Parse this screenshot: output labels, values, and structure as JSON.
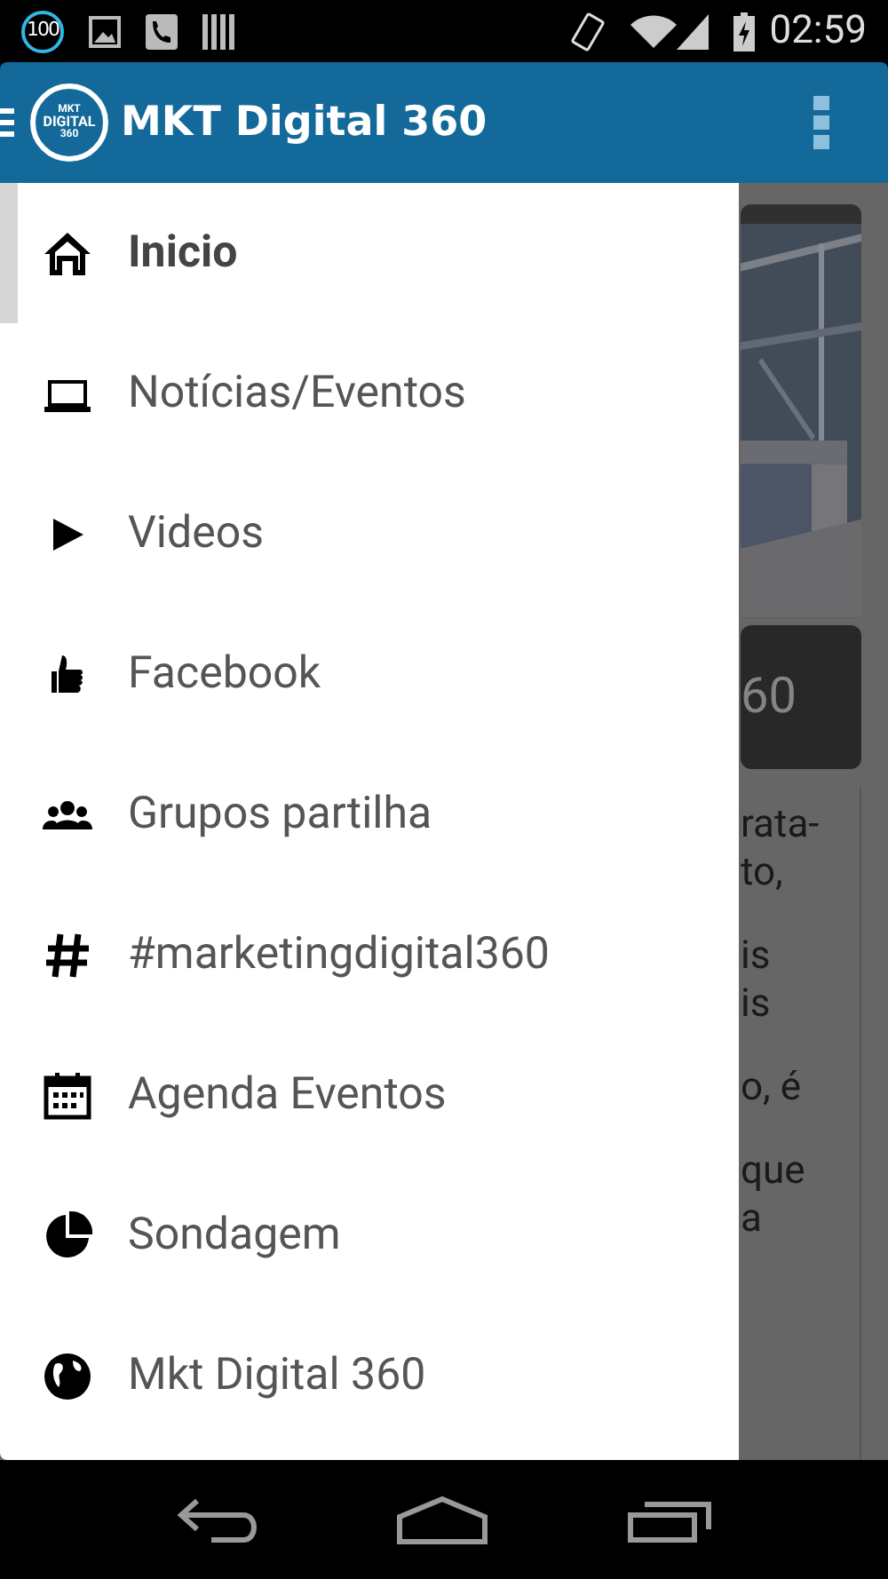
{
  "status_bar": {
    "notification_badge": "100",
    "time": "02:59"
  },
  "app_bar": {
    "logo_lines": [
      "MKT",
      "DIGITAL",
      "360"
    ],
    "title": "MKT Digital 360"
  },
  "background": {
    "banner_text": "60",
    "paragraphs": [
      [
        "rata-",
        "to,"
      ],
      [
        "is",
        "is"
      ],
      [
        "o, é"
      ],
      [
        "que",
        "a"
      ]
    ]
  },
  "drawer": {
    "items": [
      {
        "kind": "home",
        "label": "Inicio",
        "selected": true
      },
      {
        "kind": "laptop",
        "label": "Notícias/Eventos",
        "selected": false
      },
      {
        "kind": "play",
        "label": "Videos",
        "selected": false
      },
      {
        "kind": "thumb",
        "label": "Facebook",
        "selected": false
      },
      {
        "kind": "group",
        "label": "Grupos partilha",
        "selected": false
      },
      {
        "kind": "hash",
        "label": "#marketingdigital360",
        "selected": false
      },
      {
        "kind": "calendar",
        "label": "Agenda Eventos",
        "selected": false
      },
      {
        "kind": "pie",
        "label": "Sondagem",
        "selected": false
      },
      {
        "kind": "globe",
        "label": "Mkt Digital 360",
        "selected": false
      }
    ]
  }
}
